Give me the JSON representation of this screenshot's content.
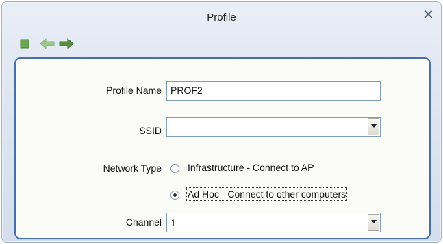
{
  "window": {
    "title": "Profile",
    "close_glyph": "✕"
  },
  "toolbar": {
    "buttons": [
      {
        "name": "stop-icon",
        "color": "#6aa84f"
      },
      {
        "name": "back-arrow-icon",
        "color": "#9cc78f"
      },
      {
        "name": "forward-arrow-icon",
        "color": "#5b8d3f"
      }
    ]
  },
  "form": {
    "profile_name": {
      "label": "Profile Name",
      "value": "PROF2"
    },
    "ssid": {
      "label": "SSID",
      "value": ""
    },
    "network_type": {
      "label": "Network Type",
      "options": [
        {
          "label": "Infrastructure - Connect to AP",
          "selected": false
        },
        {
          "label": "Ad Hoc - Connect to other computers",
          "selected": true
        }
      ]
    },
    "channel": {
      "label": "Channel",
      "value": "1"
    }
  }
}
